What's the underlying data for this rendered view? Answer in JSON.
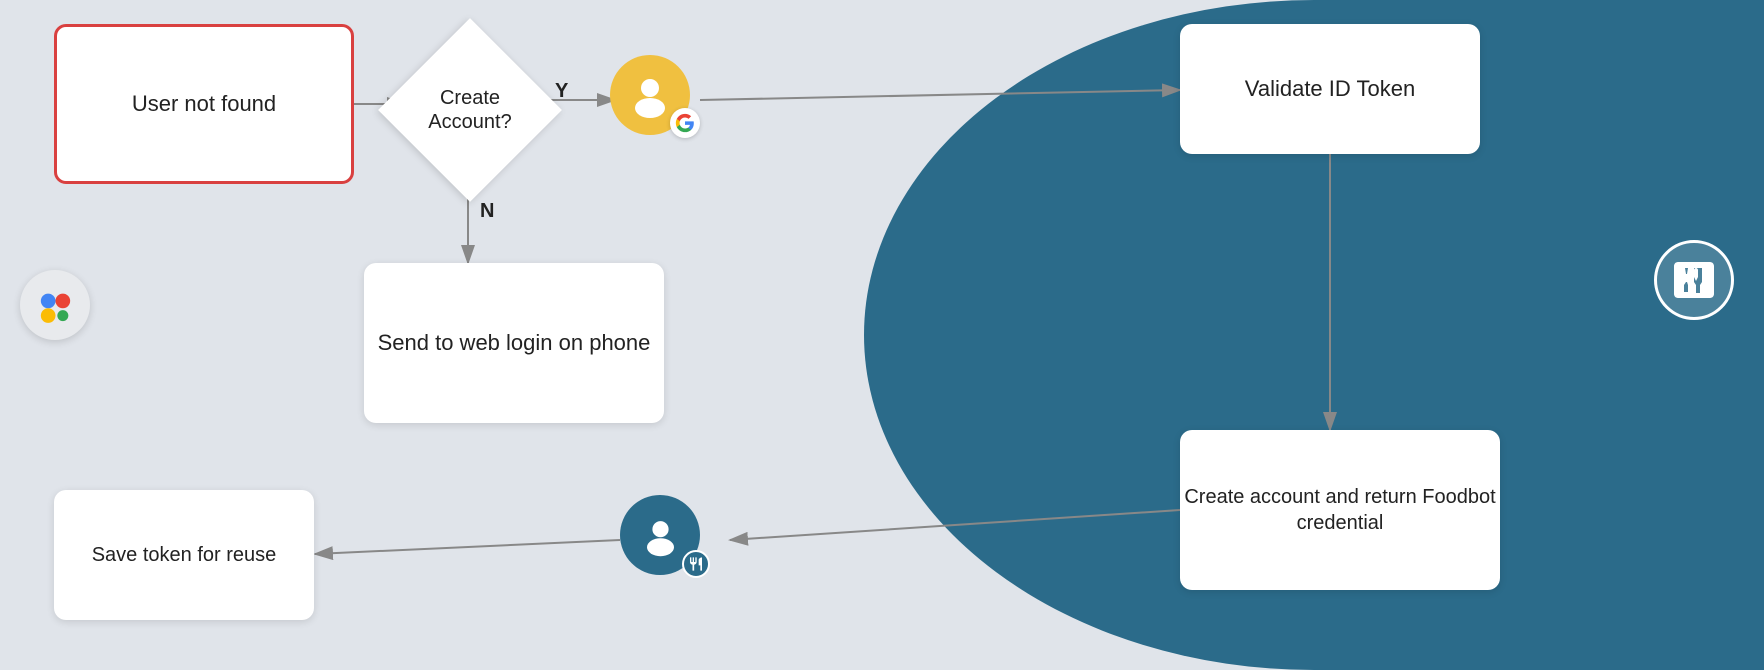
{
  "background": {
    "left_color": "#e0e4ea",
    "right_color": "#2b6b8a"
  },
  "nodes": {
    "user_not_found": "User not found",
    "create_account_question": "Create\nAccount?",
    "send_to_web_login": "Send to web login\non phone",
    "save_token": "Save token\nfor reuse",
    "validate_id": "Validate ID\nToken",
    "create_account": "Create account and\nreturn Foodbot\ncredential"
  },
  "labels": {
    "yes": "Y",
    "no": "N"
  },
  "icons": {
    "google_user": "google-user-icon",
    "foodbot_user": "foodbot-user-icon",
    "google_assistant": "google-assistant-icon",
    "foodbot_right": "foodbot-right-icon"
  }
}
